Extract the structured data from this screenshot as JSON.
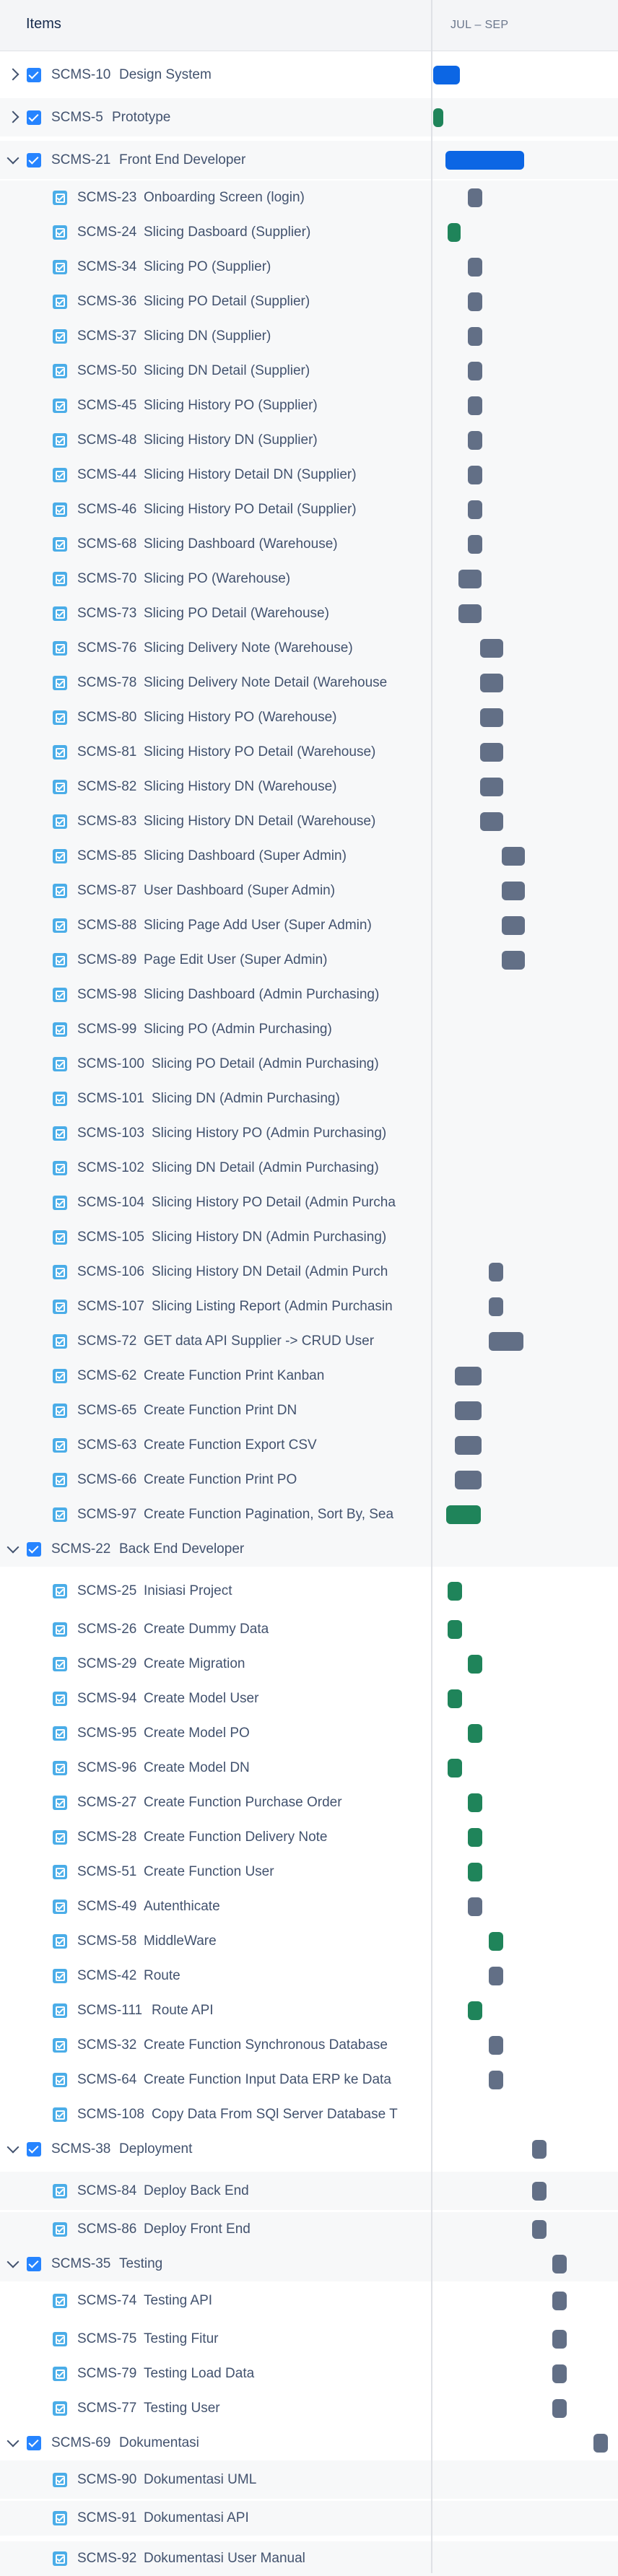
{
  "header": {
    "items_label": "Items",
    "timeline_label": "JUL – SEP"
  },
  "colors": {
    "blue": "#0c66e4",
    "green": "#1f845a",
    "grey": "#626f86",
    "band": "#f7f8f9",
    "checkbox": "#2684ff",
    "task_icon": "#4bade8"
  },
  "rows": [
    {
      "type": "epic",
      "expand": "collapsed",
      "key": "SCMS-10",
      "summary": "Design System",
      "bar": "blue"
    },
    {
      "type": "epic",
      "expand": "collapsed",
      "key": "SCMS-5",
      "summary": "Prototype",
      "bar": "green"
    },
    {
      "type": "epic",
      "expand": "expanded",
      "key": "SCMS-21",
      "summary": "Front End Developer",
      "bar": "blue"
    },
    {
      "type": "task",
      "key": "SCMS-23",
      "summary": "Onboarding Screen (login)",
      "bar": "grey"
    },
    {
      "type": "task",
      "key": "SCMS-24",
      "summary": "Slicing Dasboard (Supplier)",
      "bar": "green"
    },
    {
      "type": "task",
      "key": "SCMS-34",
      "summary": "Slicing PO (Supplier)",
      "bar": "grey"
    },
    {
      "type": "task",
      "key": "SCMS-36",
      "summary": "Slicing PO Detail (Supplier)",
      "bar": "grey"
    },
    {
      "type": "task",
      "key": "SCMS-37",
      "summary": "Slicing DN (Supplier)",
      "bar": "grey"
    },
    {
      "type": "task",
      "key": "SCMS-50",
      "summary": "Slicing DN Detail (Supplier)",
      "bar": "grey"
    },
    {
      "type": "task",
      "key": "SCMS-45",
      "summary": "Slicing History PO (Supplier)",
      "bar": "grey"
    },
    {
      "type": "task",
      "key": "SCMS-48",
      "summary": "Slicing History DN (Supplier)",
      "bar": "grey"
    },
    {
      "type": "task",
      "key": "SCMS-44",
      "summary": "Slicing History Detail DN (Supplier)",
      "bar": "grey"
    },
    {
      "type": "task",
      "key": "SCMS-46",
      "summary": "Slicing History PO Detail (Supplier)",
      "bar": "grey"
    },
    {
      "type": "task",
      "key": "SCMS-68",
      "summary": "Slicing Dashboard (Warehouse)",
      "bar": "grey"
    },
    {
      "type": "task",
      "key": "SCMS-70",
      "summary": "Slicing PO (Warehouse)",
      "bar": "grey"
    },
    {
      "type": "task",
      "key": "SCMS-73",
      "summary": "Slicing PO Detail (Warehouse)",
      "bar": "grey"
    },
    {
      "type": "task",
      "key": "SCMS-76",
      "summary": "Slicing Delivery Note (Warehouse)",
      "bar": "grey"
    },
    {
      "type": "task",
      "key": "SCMS-78",
      "summary": "Slicing Delivery Note Detail (Warehouse",
      "bar": "grey"
    },
    {
      "type": "task",
      "key": "SCMS-80",
      "summary": "Slicing History PO (Warehouse)",
      "bar": "grey"
    },
    {
      "type": "task",
      "key": "SCMS-81",
      "summary": "Slicing History PO Detail (Warehouse)",
      "bar": "grey"
    },
    {
      "type": "task",
      "key": "SCMS-82",
      "summary": "Slicing History DN (Warehouse)",
      "bar": "grey"
    },
    {
      "type": "task",
      "key": "SCMS-83",
      "summary": "Slicing History DN Detail (Warehouse)",
      "bar": "grey"
    },
    {
      "type": "task",
      "key": "SCMS-85",
      "summary": "Slicing Dashboard (Super Admin)",
      "bar": "grey"
    },
    {
      "type": "task",
      "key": "SCMS-87",
      "summary": "User Dashboard (Super Admin)",
      "bar": "grey"
    },
    {
      "type": "task",
      "key": "SCMS-88",
      "summary": "Slicing Page Add User (Super Admin)",
      "bar": "grey"
    },
    {
      "type": "task",
      "key": "SCMS-89",
      "summary": "Page Edit User (Super Admin)",
      "bar": "grey"
    },
    {
      "type": "task",
      "key": "SCMS-98",
      "summary": "Slicing Dashboard (Admin Purchasing)",
      "bar": null
    },
    {
      "type": "task",
      "key": "SCMS-99",
      "summary": "Slicing PO (Admin Purchasing)",
      "bar": null
    },
    {
      "type": "task",
      "key": "SCMS-100",
      "summary": "Slicing PO Detail (Admin Purchasing)",
      "bar": null
    },
    {
      "type": "task",
      "key": "SCMS-101",
      "summary": "Slicing DN (Admin Purchasing)",
      "bar": null
    },
    {
      "type": "task",
      "key": "SCMS-103",
      "summary": "Slicing History PO (Admin Purchasing)",
      "bar": null
    },
    {
      "type": "task",
      "key": "SCMS-102",
      "summary": "Slicing DN Detail (Admin Purchasing)",
      "bar": null
    },
    {
      "type": "task",
      "key": "SCMS-104",
      "summary": "Slicing History PO Detail (Admin Purcha",
      "bar": null
    },
    {
      "type": "task",
      "key": "SCMS-105",
      "summary": "Slicing History DN (Admin Purchasing)",
      "bar": null
    },
    {
      "type": "task",
      "key": "SCMS-106",
      "summary": "Slicing History DN Detail (Admin Purch",
      "bar": "grey"
    },
    {
      "type": "task",
      "key": "SCMS-107",
      "summary": "Slicing Listing Report (Admin Purchasin",
      "bar": "grey"
    },
    {
      "type": "task",
      "key": "SCMS-72",
      "summary": "GET data API Supplier -> CRUD User",
      "bar": "grey"
    },
    {
      "type": "task",
      "key": "SCMS-62",
      "summary": "Create Function Print Kanban",
      "bar": "grey"
    },
    {
      "type": "task",
      "key": "SCMS-65",
      "summary": "Create Function Print DN",
      "bar": "grey"
    },
    {
      "type": "task",
      "key": "SCMS-63",
      "summary": "Create Function Export CSV",
      "bar": "grey"
    },
    {
      "type": "task",
      "key": "SCMS-66",
      "summary": "Create Function Print PO",
      "bar": "grey"
    },
    {
      "type": "task",
      "key": "SCMS-97",
      "summary": "Create Function Pagination, Sort By, Sea",
      "bar": "green"
    },
    {
      "type": "epic",
      "expand": "expanded",
      "key": "SCMS-22",
      "summary": "Back End Developer",
      "bar": null
    },
    {
      "type": "task",
      "key": "SCMS-25",
      "summary": "Inisiasi Project",
      "bar": "green"
    },
    {
      "type": "task",
      "key": "SCMS-26",
      "summary": "Create Dummy Data",
      "bar": "green"
    },
    {
      "type": "task",
      "key": "SCMS-29",
      "summary": "Create Migration",
      "bar": "green"
    },
    {
      "type": "task",
      "key": "SCMS-94",
      "summary": "Create Model User",
      "bar": "green"
    },
    {
      "type": "task",
      "key": "SCMS-95",
      "summary": "Create Model PO",
      "bar": "green"
    },
    {
      "type": "task",
      "key": "SCMS-96",
      "summary": "Create Model DN",
      "bar": "green"
    },
    {
      "type": "task",
      "key": "SCMS-27",
      "summary": "Create Function Purchase Order",
      "bar": "green"
    },
    {
      "type": "task",
      "key": "SCMS-28",
      "summary": "Create Function Delivery Note",
      "bar": "green"
    },
    {
      "type": "task",
      "key": "SCMS-51",
      "summary": "Create Function User",
      "bar": "green"
    },
    {
      "type": "task",
      "key": "SCMS-49",
      "summary": "Autenthicate",
      "bar": "grey"
    },
    {
      "type": "task",
      "key": "SCMS-58",
      "summary": "MiddleWare",
      "bar": "green"
    },
    {
      "type": "task",
      "key": "SCMS-42",
      "summary": "Route",
      "bar": "grey"
    },
    {
      "type": "task",
      "key": "SCMS-111",
      "summary": "Route API",
      "bar": "green"
    },
    {
      "type": "task",
      "key": "SCMS-32",
      "summary": "Create Function Synchronous Database",
      "bar": "grey"
    },
    {
      "type": "task",
      "key": "SCMS-64",
      "summary": "Create Function Input Data ERP ke Data",
      "bar": "grey"
    },
    {
      "type": "task",
      "key": "SCMS-108",
      "summary": "Copy Data From SQl Server Database T",
      "bar": null
    },
    {
      "type": "epic",
      "expand": "expanded",
      "key": "SCMS-38",
      "summary": "Deployment",
      "bar": "grey"
    },
    {
      "type": "task",
      "key": "SCMS-84",
      "summary": "Deploy Back End",
      "bar": "grey"
    },
    {
      "type": "task",
      "key": "SCMS-86",
      "summary": "Deploy Front End",
      "bar": "grey"
    },
    {
      "type": "epic",
      "expand": "expanded",
      "key": "SCMS-35",
      "summary": "Testing",
      "bar": "grey"
    },
    {
      "type": "task",
      "key": "SCMS-74",
      "summary": "Testing API",
      "bar": "grey"
    },
    {
      "type": "task",
      "key": "SCMS-75",
      "summary": "Testing Fitur",
      "bar": "grey"
    },
    {
      "type": "task",
      "key": "SCMS-79",
      "summary": "Testing Load Data",
      "bar": "grey"
    },
    {
      "type": "task",
      "key": "SCMS-77",
      "summary": "Testing User",
      "bar": "grey"
    },
    {
      "type": "epic",
      "expand": "expanded",
      "key": "SCMS-69",
      "summary": "Dokumentasi",
      "bar": "grey"
    },
    {
      "type": "task",
      "key": "SCMS-90",
      "summary": "Dokumentasi UML",
      "bar": null
    },
    {
      "type": "task",
      "key": "SCMS-91",
      "summary": "Dokumentasi API",
      "bar": null
    },
    {
      "type": "task",
      "key": "SCMS-92",
      "summary": "Dokumentasi User Manual",
      "bar": null
    }
  ]
}
